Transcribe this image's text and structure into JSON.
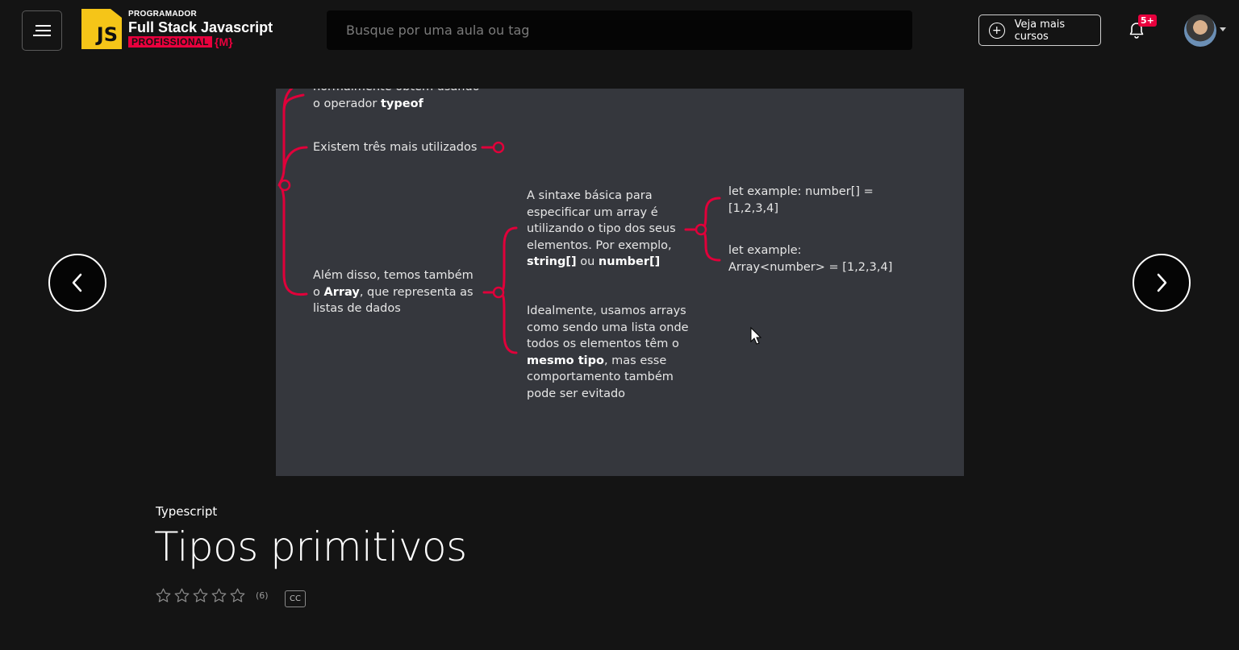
{
  "header": {
    "logo": {
      "js_text": "JS",
      "line1": "PROGRAMADOR",
      "line2": "Full Stack Javascript",
      "line3": "PROFISSIONAL",
      "brace": "{M}"
    },
    "search_placeholder": "Busque por uma aula ou tag",
    "more_courses_label": "Veja mais cursos",
    "notifications_badge": "5+"
  },
  "slide": {
    "mindmap": {
      "node_typeof_line1": "normalmente obtém usando",
      "node_typeof_line2_pre": "o operador ",
      "node_typeof_line2_bold": "typeof",
      "node_three": "Existem três mais utilizados",
      "node_array_line1": "Além disso, temos também",
      "node_array_line2_pre": "o ",
      "node_array_line2_bold": "Array",
      "node_array_line2_post": ", que representa as",
      "node_array_line3": "listas de dados",
      "node_syntax_line1": "A sintaxe básica para",
      "node_syntax_line2": "especificar um array é",
      "node_syntax_line3": "utilizando o tipo dos seus",
      "node_syntax_line4": "elementos. Por exemplo,",
      "node_syntax_bold1": "string[]",
      "node_syntax_mid": " ou ",
      "node_syntax_bold2": "number[]",
      "node_ex1_line1": "let example: number[] =",
      "node_ex1_line2": "[1,2,3,4]",
      "node_ex2_line1": "let example:",
      "node_ex2_line2": "Array<number> = [1,2,3,4]",
      "node_ideal_line1": "Idealmente, usamos arrays",
      "node_ideal_line2": "como sendo uma lista onde",
      "node_ideal_line3": "todos os elementos têm o",
      "node_ideal_bold": "mesmo tipo",
      "node_ideal_line4_post": ", mas esse",
      "node_ideal_line5": "comportamento também",
      "node_ideal_line6": "pode ser evitado"
    }
  },
  "lesson": {
    "course": "Typescript",
    "title": "Tipos primitivos",
    "stars_filled": 0,
    "stars_total": 5,
    "rating_count": "(6)",
    "cc_label": "CC"
  },
  "icons": {
    "menu": "hamburger-menu-icon",
    "plus": "plus-circle-icon",
    "bell": "bell-icon",
    "prev": "chevron-left-icon",
    "next": "chevron-right-icon",
    "cursor": "mouse-cursor-icon"
  },
  "colors": {
    "accent": "#e8003d",
    "js_yellow": "#f5c518",
    "slide_bg": "#35373d",
    "page_bg": "#141414"
  }
}
